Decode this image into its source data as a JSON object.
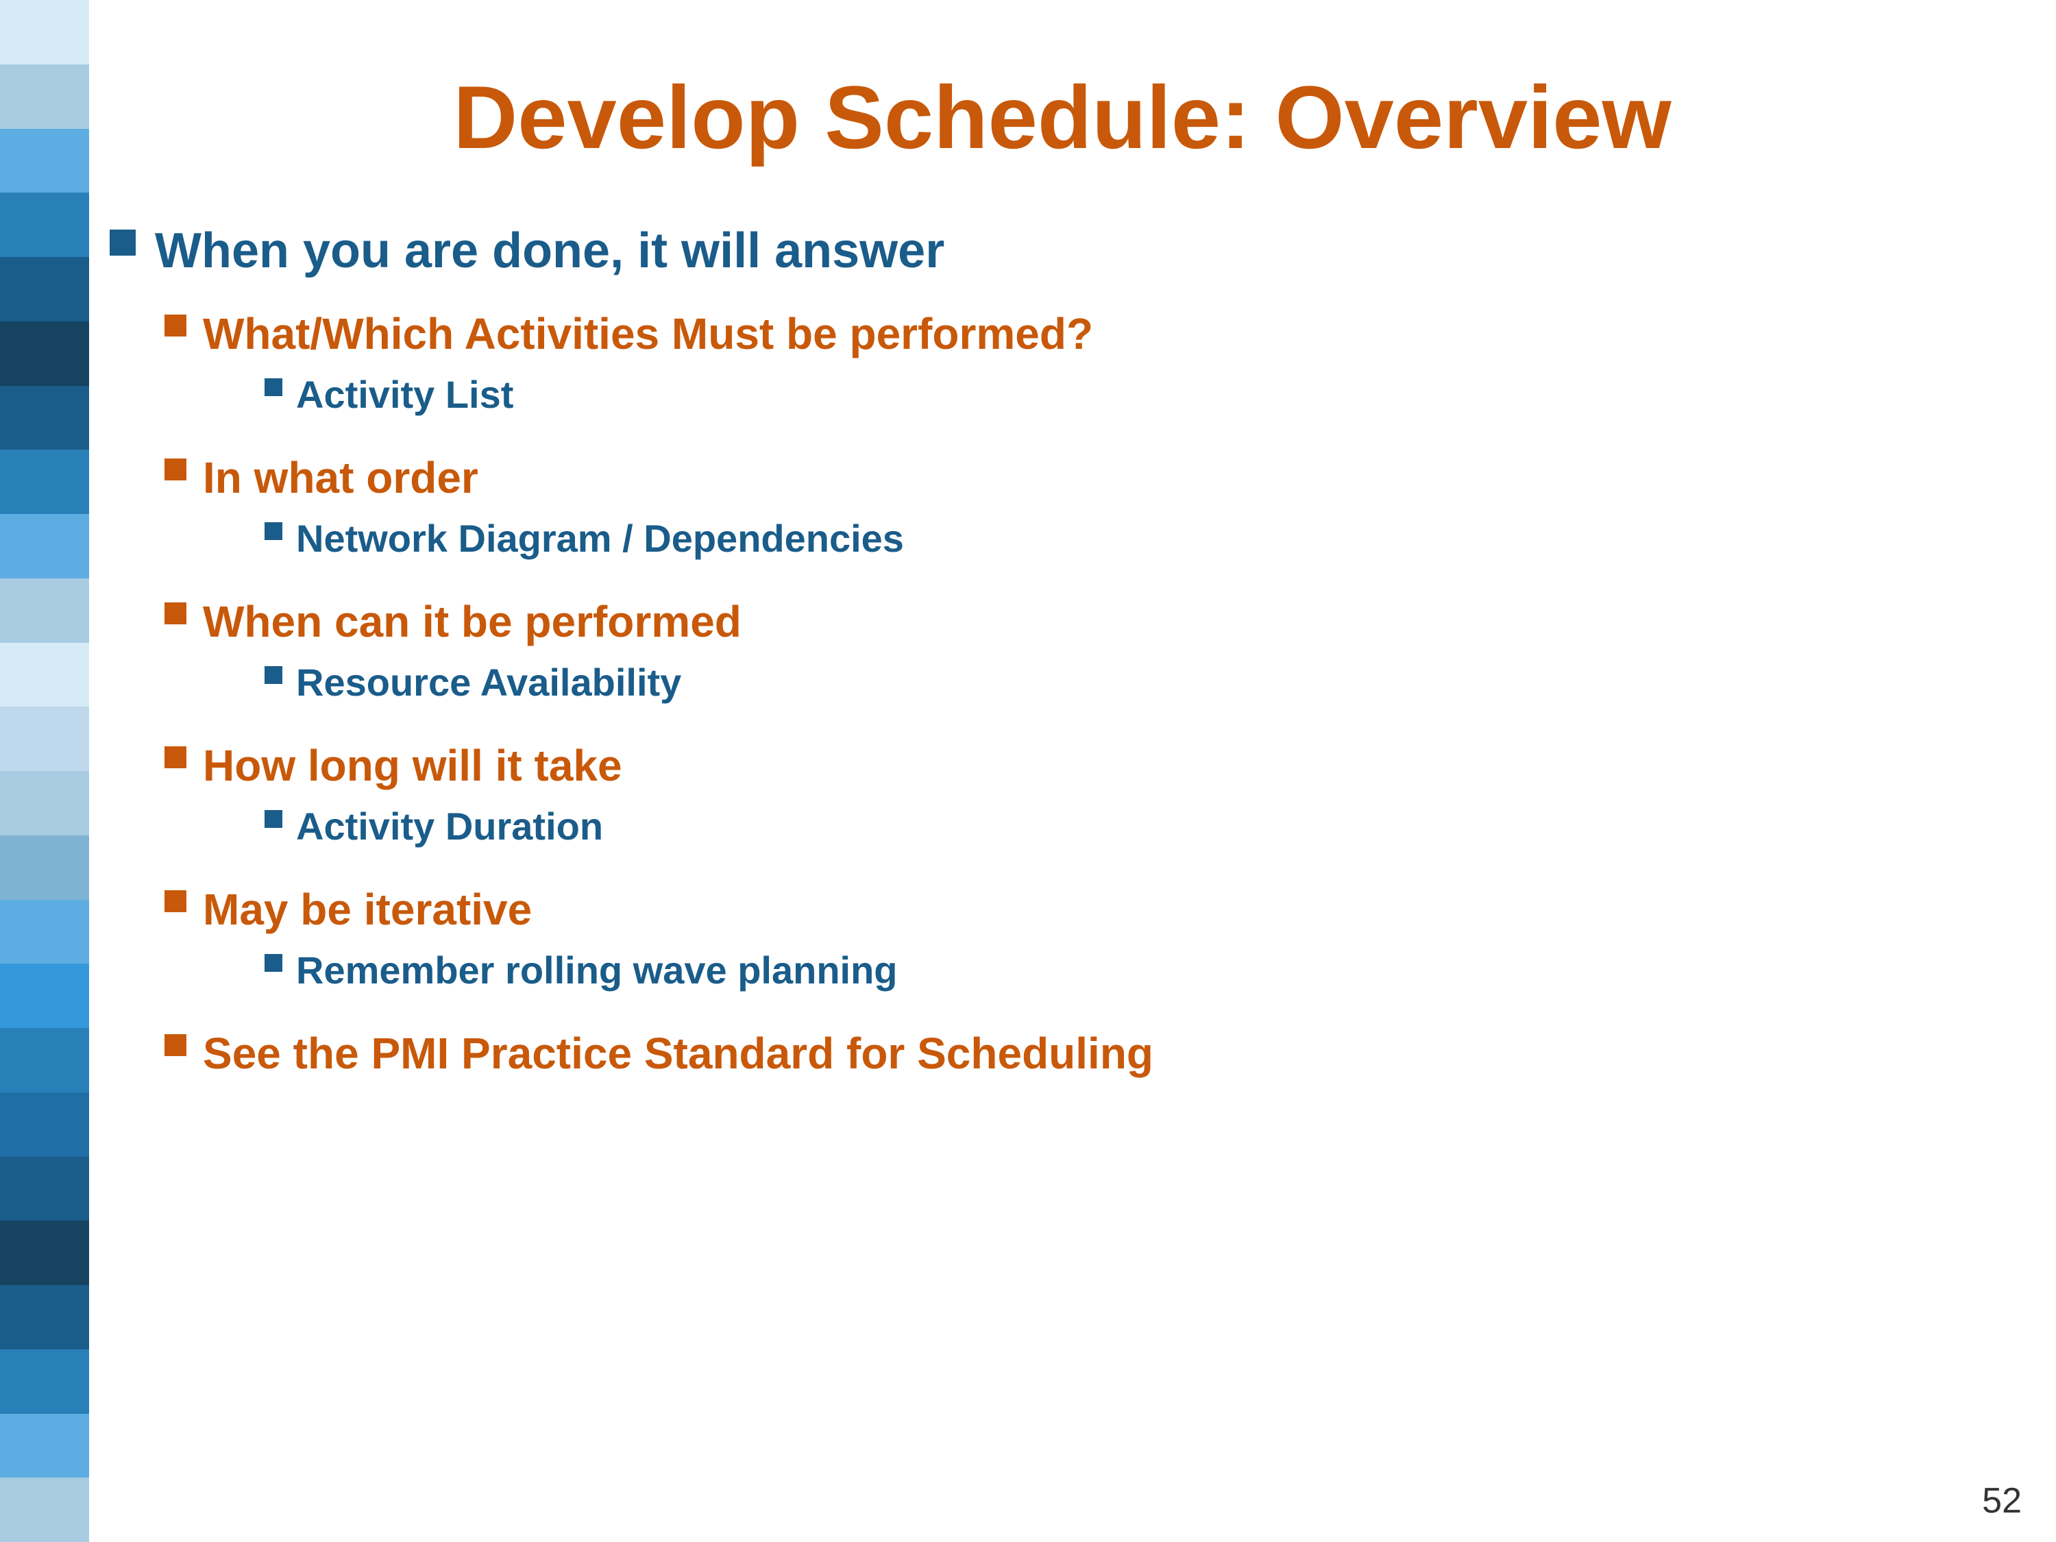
{
  "slide": {
    "title": "Develop Schedule: Overview",
    "page_number": "52",
    "colors": {
      "orange": "#c8590a",
      "blue_dark": "#1a5c8a",
      "blue_medium": "#2980b9",
      "blue_light": "#5dade2",
      "blue_lighter": "#a9cce3",
      "blue_lightest": "#d6eaf8"
    },
    "level1": [
      {
        "text": "When you are done, it will answer",
        "children": []
      },
      {
        "text": "What/Which Activities Must be performed?",
        "children": [
          {
            "text": "Activity List",
            "children": []
          }
        ]
      },
      {
        "text": "In what order",
        "children": [
          {
            "text": "Network Diagram / Dependencies",
            "children": []
          }
        ]
      },
      {
        "text": "When can it be performed",
        "children": [
          {
            "text": "Resource Availability",
            "children": []
          }
        ]
      },
      {
        "text": "How long will it take",
        "children": [
          {
            "text": "Activity Duration",
            "children": []
          }
        ]
      },
      {
        "text": "May be iterative",
        "children": [
          {
            "text": "Remember rolling wave planning",
            "children": []
          }
        ]
      },
      {
        "text": "See the PMI Practice Standard for Scheduling",
        "children": []
      }
    ]
  },
  "strip": {
    "blocks": [
      "#d6eaf8",
      "#a9cce3",
      "#5dade2",
      "#2980b9",
      "#1a5c8a",
      "#154360",
      "#1a5c8a",
      "#2980b9",
      "#5dade2",
      "#a9cce3",
      "#d6eaf8",
      "#c0d8ec",
      "#a9cce3",
      "#7fb3d3",
      "#5dade2",
      "#3498db",
      "#2980b9",
      "#1f6ea6",
      "#1a5c8a",
      "#154360",
      "#1a5c8a",
      "#2980b9",
      "#5dade2",
      "#a9cce3"
    ]
  }
}
